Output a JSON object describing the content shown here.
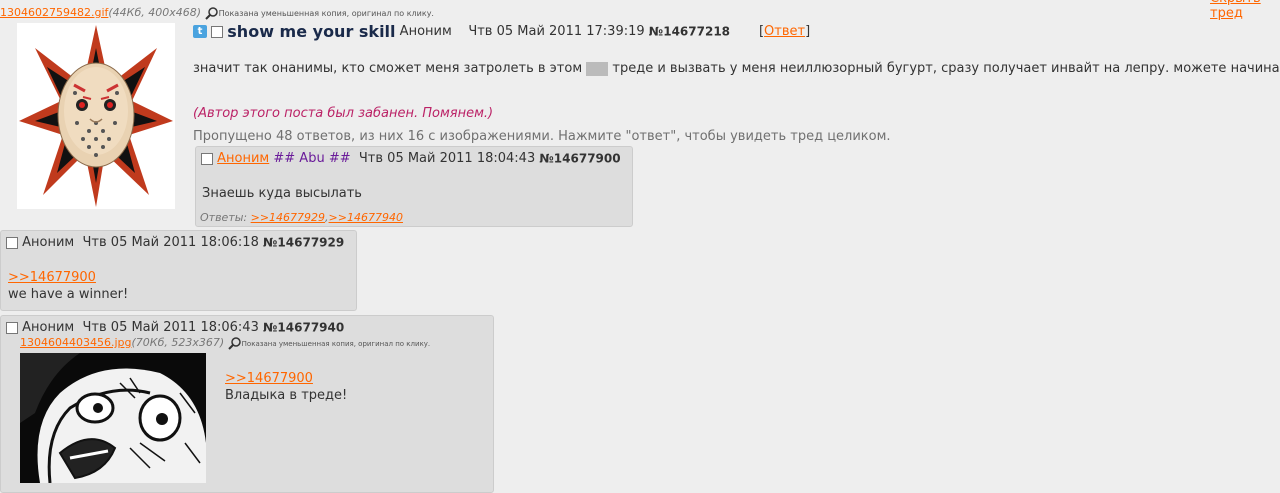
{
  "top_file": {
    "link": "1304602759482.gif",
    "meta": "(44Кб, 400x468)",
    "note": "Показана уменьшенная копия, оригинал по клику."
  },
  "hide_link": "Скрыть тред",
  "op": {
    "title": "show me your skill",
    "name": "Аноним",
    "date": "Чтв 05 Май 2011 17:39:19",
    "number": "№14677218",
    "reply_open": "[",
    "reply_label": "Ответ",
    "reply_close": "]",
    "text_before": "значит так онанимы, кто сможет меня затролеть в этом",
    "text_after": "треде и вызвать у меня неиллюзорный бугурт, сразу получает инвайт на лепру. можете начинать",
    "ban_note": "(Автор этого поста был забанен. Помянем.)",
    "omitted": "Пропущено 48 ответов, из них 16 с изображениями. Нажмите \"ответ\", чтобы увидеть тред целиком."
  },
  "posts": [
    {
      "name": "Аноним",
      "trip": "## Abu ##",
      "date": "Чтв 05 Май 2011 18:04:43",
      "number": "№14677900",
      "text": "Знаешь куда высылать",
      "replies_label": "Ответы:",
      "reply1": ">>14677929",
      "reply_sep": ",",
      "reply2": ">>14677940"
    },
    {
      "name": "Аноним",
      "date": "Чтв 05 Май 2011 18:06:18",
      "number": "№14677929",
      "quote": ">>14677900",
      "text": "we have a winner!"
    },
    {
      "name": "Аноним",
      "date": "Чтв 05 Май 2011 18:06:43",
      "number": "№14677940",
      "file_link": "1304604403456.jpg",
      "file_meta": "(70Кб, 523x367)",
      "file_note": "Показана уменьшенная копия, оригинал по клику.",
      "quote": ">>14677900",
      "text": "Владыка в треде!"
    }
  ],
  "colors": {
    "link": "#ff6600",
    "ban": "#bb2266",
    "trip": "#6a1b9a",
    "title": "#1a2a4a",
    "background": "#eeeeee",
    "reply_bg": "#dddddd"
  }
}
